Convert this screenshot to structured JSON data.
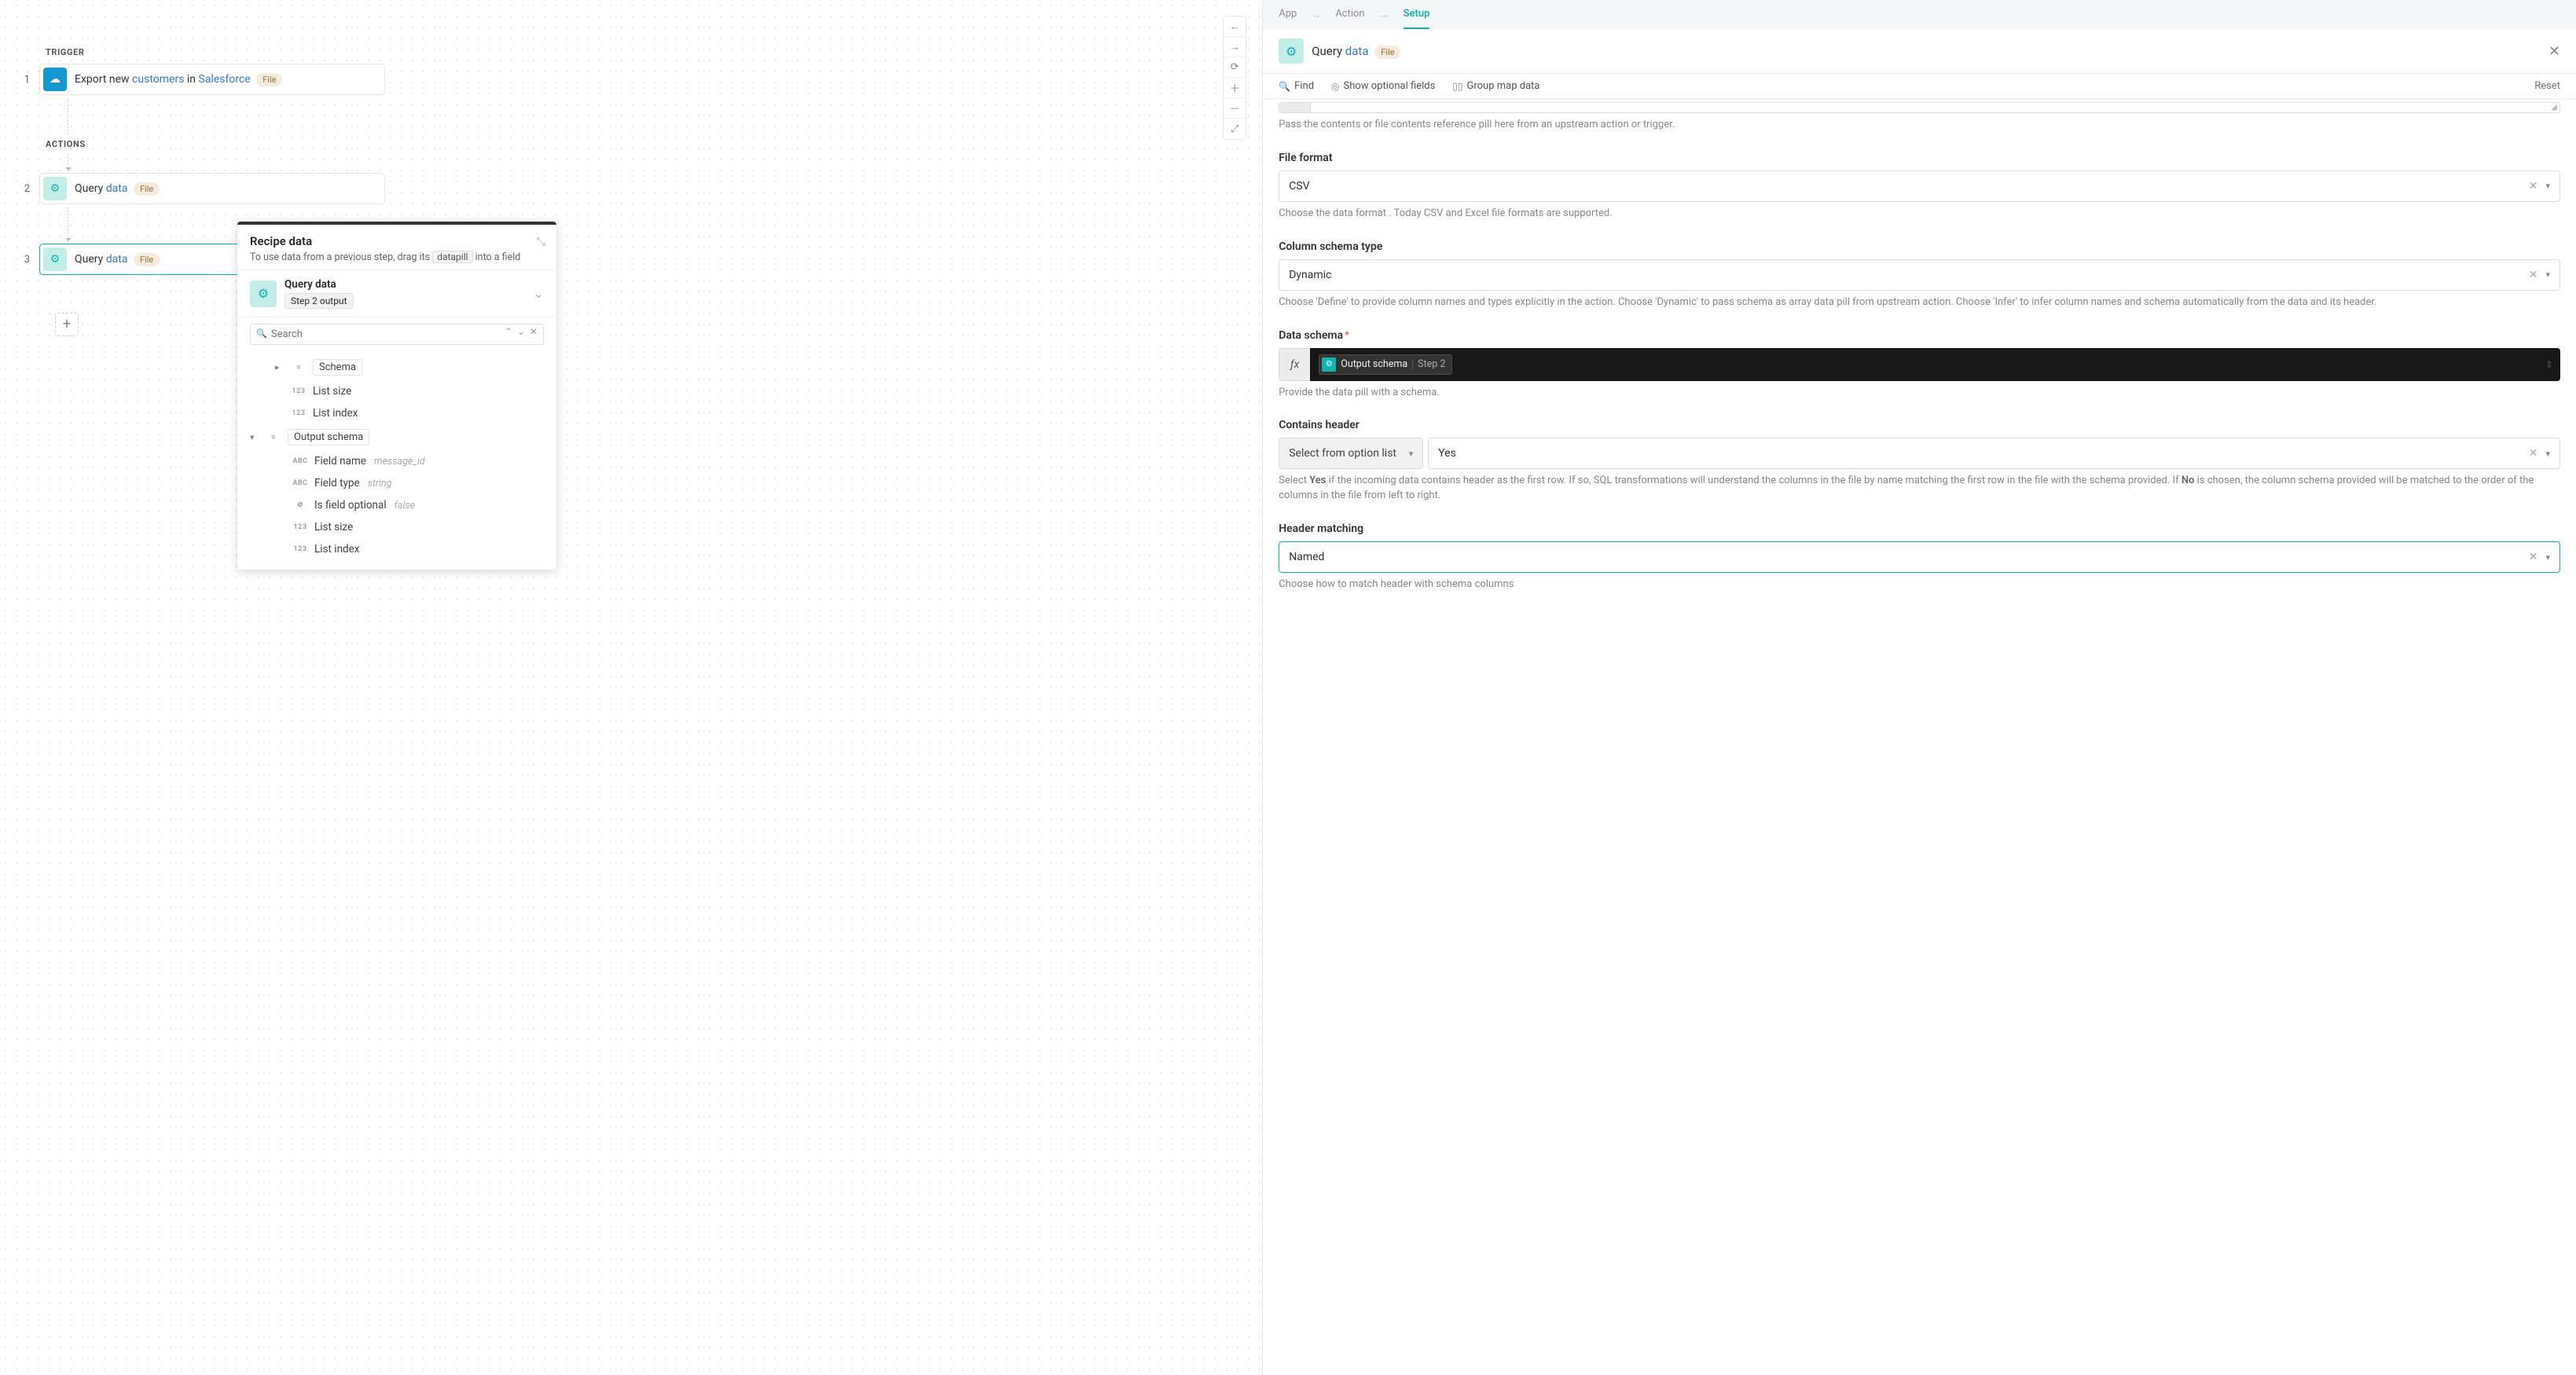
{
  "leftPane": {
    "triggerLabel": "TRIGGER",
    "actionsLabel": "ACTIONS",
    "nodes": {
      "one": {
        "num": "1",
        "prefix": "Export new ",
        "link1": "customers",
        "mid": " in ",
        "link2": "Salesforce",
        "pill": "File"
      },
      "two": {
        "num": "2",
        "prefix": "Query ",
        "link1": "data",
        "pill": "File"
      },
      "three": {
        "num": "3",
        "prefix": "Query ",
        "link1": "data",
        "pill": "File"
      }
    }
  },
  "popover": {
    "title": "Recipe data",
    "hintBefore": "To use data from a previous step, drag its ",
    "chip": "datapill",
    "hintAfter": " into a field",
    "source": {
      "title": "Query data",
      "sub": "Step 2 output"
    },
    "searchPlaceholder": "Search",
    "tree": {
      "schema": "Schema",
      "listSize": "List size",
      "listIndex": "List index",
      "outputSchema": "Output schema",
      "fieldName": "Field name",
      "fieldNameHint": "message_id",
      "fieldType": "Field type",
      "fieldTypeHint": "string",
      "isFieldOptional": "Is field optional",
      "isFieldOptionalHint": "false",
      "listSize2": "List size",
      "listIndex2": "List index"
    }
  },
  "rightPane": {
    "breadcrumb": {
      "app": "App",
      "action": "Action",
      "setup": "Setup"
    },
    "header": {
      "prefix": "Query ",
      "link": "data",
      "pill": "File"
    },
    "actionBar": {
      "find": "Find",
      "optional": "Show optional fields",
      "group": "Group map data",
      "reset": "Reset"
    },
    "form": {
      "topHelp": "Pass the contents or file contents reference pill here from an upstream action or trigger.",
      "fileFormat": {
        "label": "File format",
        "value": "CSV",
        "help": "Choose the data format . Today CSV and Excel file formats are supported."
      },
      "columnSchema": {
        "label": "Column schema type",
        "value": "Dynamic",
        "help": "Choose 'Define' to provide column names and types explicitly in the action. Choose 'Dynamic' to pass schema as array data pill from upstream action. Choose 'Infer' to infer column names and schema automatically from the data and its header."
      },
      "dataSchema": {
        "label": "Data schema",
        "pill": "Output schema",
        "pillStep": "Step 2",
        "help": "Provide the data pill with a schema."
      },
      "containsHeader": {
        "label": "Contains header",
        "mode": "Select from option list",
        "value": "Yes",
        "help1": "Select ",
        "b1": "Yes",
        "help2": " if the incoming data contains header as the first row. If so, SQL transformations will understand the columns in the file by name matching the first row in the file with the schema provided. If ",
        "b2": "No",
        "help3": " is chosen, the column schema provided will be matched to the order of the columns in the file from left to right."
      },
      "headerMatching": {
        "label": "Header matching",
        "value": "Named",
        "help": "Choose how to match header with schema columns"
      }
    }
  }
}
